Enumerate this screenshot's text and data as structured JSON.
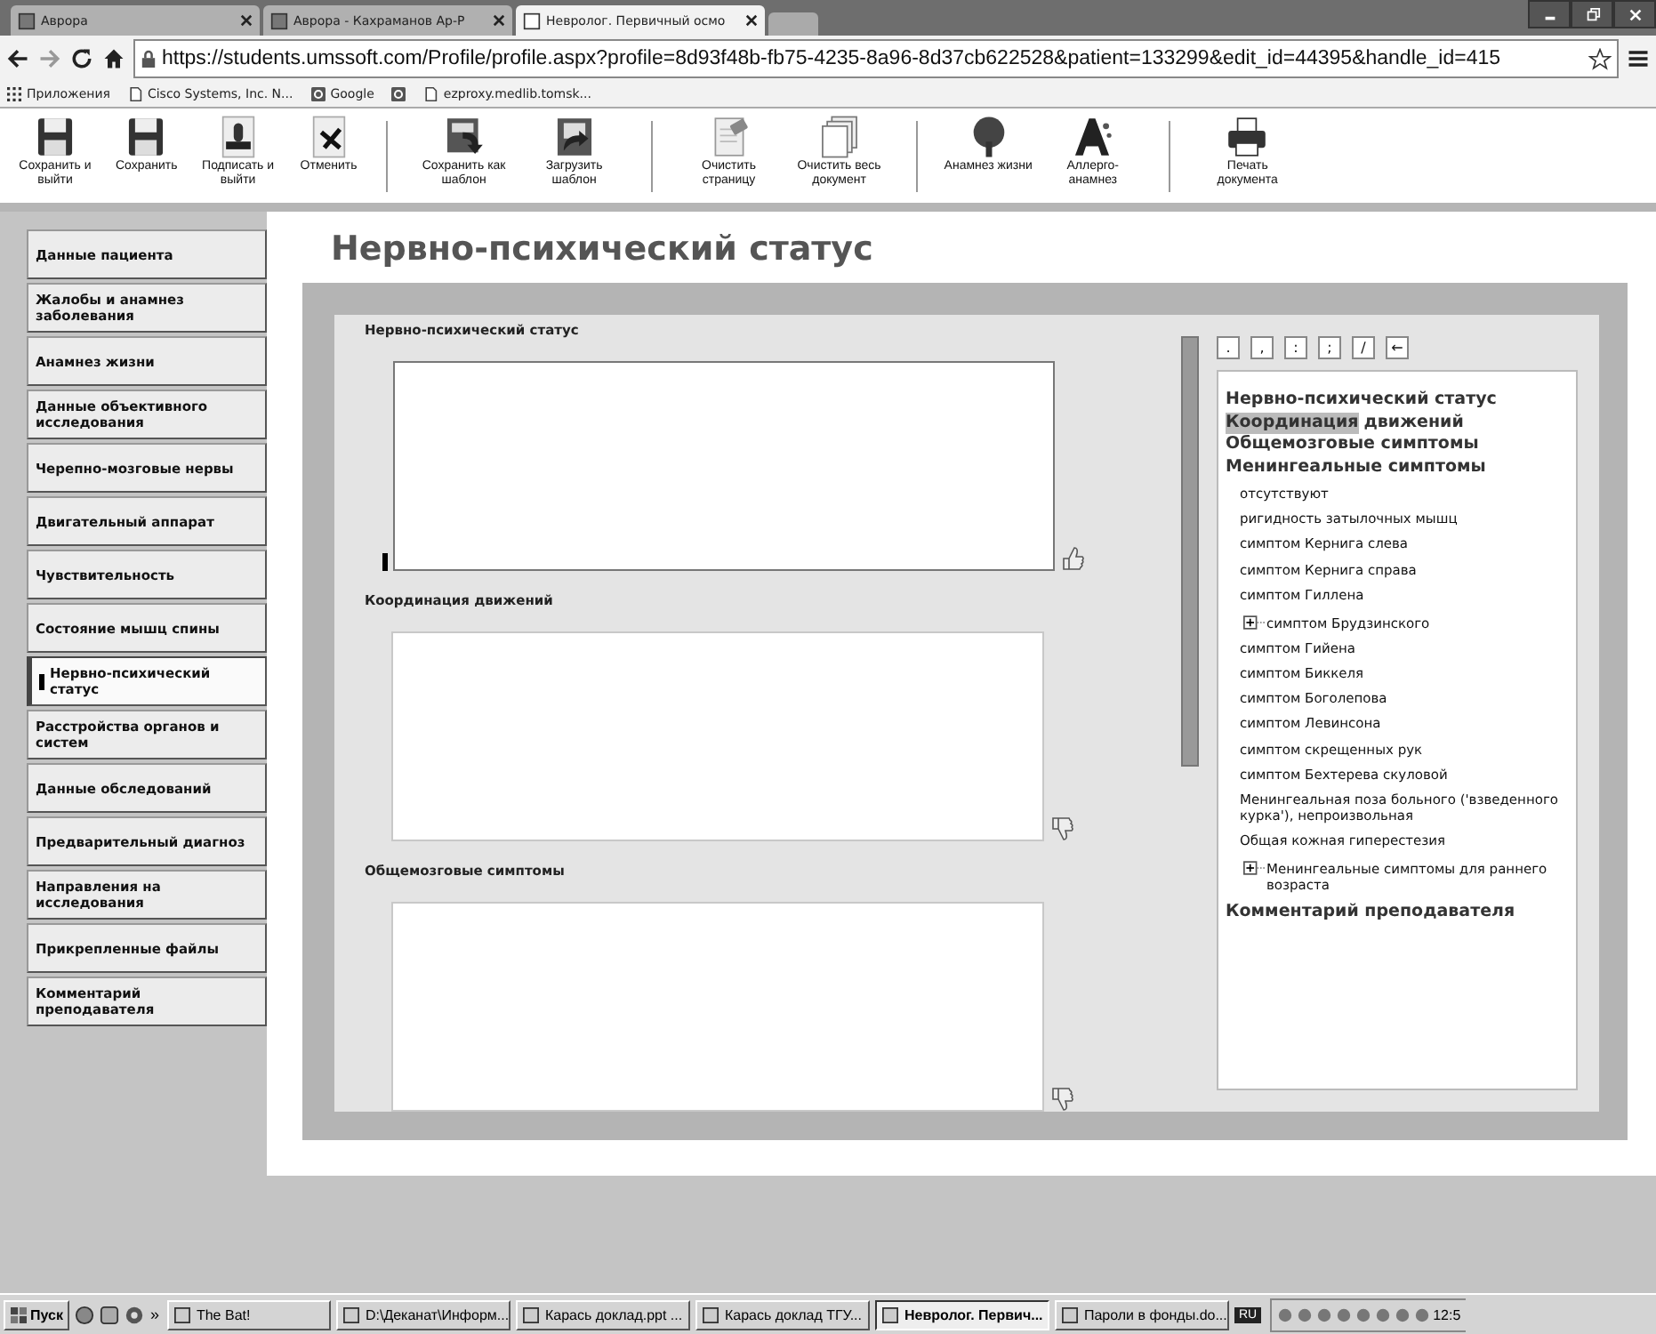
{
  "browser": {
    "tabs": [
      {
        "title": "Аврора",
        "selected": false
      },
      {
        "title": "Аврора - Кахраманов Ар-Р",
        "selected": false
      },
      {
        "title": "Невролог. Первичный осмо",
        "selected": true
      }
    ],
    "url": "https://students.umssoft.com/Profile/profile.aspx?profile=8d93f48b-fb75-4235-8a96-8d37cb622528&patient=133299&edit_id=44395&handle_id=415",
    "bookmarks": [
      {
        "kind": "apps",
        "label": "Приложения"
      },
      {
        "kind": "page",
        "label": "Cisco Systems, Inc. N..."
      },
      {
        "kind": "google",
        "label": "Google"
      },
      {
        "kind": "google"
      },
      {
        "kind": "page",
        "label": "ezproxy.medlib.tomsk..."
      }
    ]
  },
  "toolbar": [
    {
      "kind": "save",
      "label": "Сохранить и выйти",
      "separator_before": false
    },
    {
      "kind": "save",
      "label": "Сохранить",
      "separator_before": false
    },
    {
      "kind": "sign",
      "label": "Подписать и выйти",
      "separator_before": false
    },
    {
      "kind": "cancel",
      "label": "Отменить",
      "separator_before": false
    },
    {
      "kind": "save-template",
      "label": "Сохранить как шаблон",
      "separator_before": true
    },
    {
      "kind": "load-template",
      "label": "Загрузить шаблон",
      "separator_before": false
    },
    {
      "kind": "clear",
      "label": "Очистить страницу",
      "separator_before": true
    },
    {
      "kind": "clear-all",
      "label": "Очистить весь документ",
      "separator_before": false
    },
    {
      "kind": "tree",
      "label": "Анамнез жизни",
      "separator_before": true
    },
    {
      "kind": "allergy",
      "label": "Аллерго-анамнез",
      "separator_before": false
    },
    {
      "kind": "print",
      "label": "Печать документа",
      "separator_before": true
    }
  ],
  "sidebar": [
    {
      "label": "Данные пациента",
      "selected": false,
      "warning": false
    },
    {
      "label": "Жалобы и анамнез заболевания",
      "selected": false,
      "warning": false
    },
    {
      "label": "Анамнез жизни",
      "selected": false,
      "warning": false
    },
    {
      "label": "Данные объективного исследования",
      "selected": false,
      "warning": false
    },
    {
      "label": "Черепно-мозговые нервы",
      "selected": false,
      "warning": false
    },
    {
      "label": "Двигательный аппарат",
      "selected": false,
      "warning": false
    },
    {
      "label": "Чувствительность",
      "selected": false,
      "warning": false
    },
    {
      "label": "Состояние мышц спины",
      "selected": false,
      "warning": false
    },
    {
      "label": "Нервно-психический статус",
      "selected": true,
      "warning": true
    },
    {
      "label": "Расстройства органов и систем",
      "selected": false,
      "warning": false
    },
    {
      "label": "Данные обследований",
      "selected": false,
      "warning": false
    },
    {
      "label": "Предварительный диагноз",
      "selected": false,
      "warning": false
    },
    {
      "label": "Направления на исследования",
      "selected": false,
      "warning": false
    },
    {
      "label": "Прикрепленные файлы",
      "selected": false,
      "warning": false
    },
    {
      "label": "Комментарий преподавателя",
      "selected": false,
      "warning": false
    }
  ],
  "page_title": "Нервно-психический статус",
  "fields": [
    {
      "label": "Нервно-психический статус",
      "warning": true,
      "thumbs_up": true
    },
    {
      "label": "Координация движений",
      "warning": false,
      "thumbs_up": false
    },
    {
      "label": "Общемозговые симптомы",
      "warning": false,
      "thumbs_up": false
    }
  ],
  "punctuation": [
    ".",
    ",",
    ":",
    ";",
    "/",
    "←"
  ],
  "tree": [
    {
      "kind": "heading",
      "text": "Нервно-психический статус"
    },
    {
      "kind": "heading",
      "highlight": "Координация",
      "text": "движений"
    },
    {
      "kind": "heading",
      "text": "Общемозговые симптомы"
    },
    {
      "kind": "heading",
      "text": "Менингеальные симптомы"
    },
    {
      "kind": "item",
      "text": "отсутствуют"
    },
    {
      "kind": "item",
      "text": "ригидность затылочных мышц"
    },
    {
      "kind": "item",
      "text": "симптом Кернига слева"
    },
    {
      "kind": "item",
      "text": "симптом Кернига справа"
    },
    {
      "kind": "item",
      "text": "симптом Гиллена"
    },
    {
      "kind": "group",
      "text": "симптом Брудзинского",
      "expanded": false
    },
    {
      "kind": "item",
      "text": "симптом Гийена"
    },
    {
      "kind": "item",
      "text": "симптом Биккеля"
    },
    {
      "kind": "item",
      "text": "симптом Боголепова"
    },
    {
      "kind": "item",
      "text": "симптом Левинсона"
    },
    {
      "kind": "item",
      "text": "симптом скрещенных рук"
    },
    {
      "kind": "item",
      "text": "симптом Бехтерева скуловой"
    },
    {
      "kind": "item",
      "text": "Менингеальная поза больного ('взведенного курка'), непроизвольная"
    },
    {
      "kind": "item",
      "text": "Общая кожная гиперестезия"
    },
    {
      "kind": "group",
      "text": "Менингеальные симптомы для раннего возраста",
      "expanded": false
    },
    {
      "kind": "heading",
      "text": "Комментарий преподавателя"
    }
  ],
  "taskbar": {
    "start": "Пуск",
    "more": "»",
    "tasks": [
      {
        "label": "The Bat!",
        "selected": false
      },
      {
        "label": "D:\\Деканат\\Информ...",
        "selected": false
      },
      {
        "label": "Карась доклад.ppt ...",
        "selected": false
      },
      {
        "label": "Карась доклад ТГУ...",
        "selected": false
      },
      {
        "label": "Невролог. Первич...",
        "selected": true
      },
      {
        "label": "Пароли в фонды.do...",
        "selected": false
      }
    ],
    "language": "RU",
    "clock": "12:5"
  }
}
